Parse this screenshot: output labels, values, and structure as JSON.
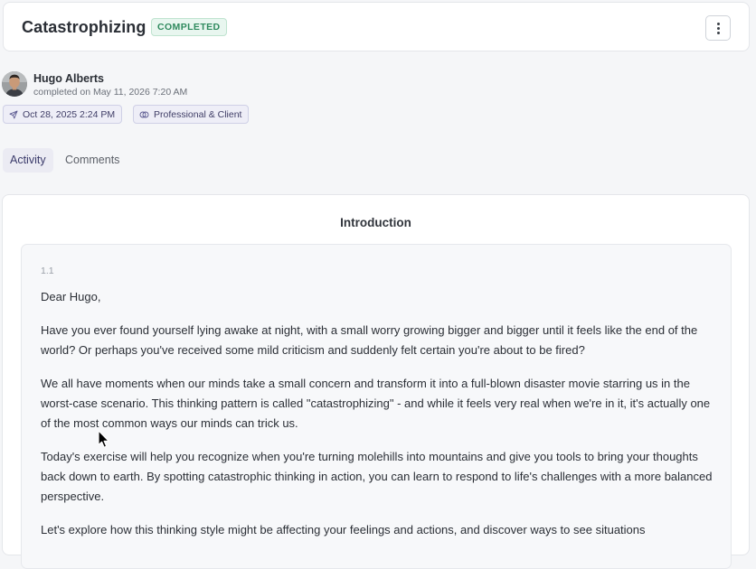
{
  "header": {
    "title": "Catastrophizing",
    "status": "COMPLETED",
    "more_icon": "more-vertical-icon"
  },
  "user": {
    "name": "Hugo Alberts",
    "completed_text": "completed on May 11, 2026 7:20 AM"
  },
  "chips": {
    "date": "Oct 28, 2025 2:24 PM",
    "relationship": "Professional & Client"
  },
  "tabs": [
    {
      "label": "Activity",
      "active": true
    },
    {
      "label": "Comments",
      "active": false
    }
  ],
  "content": {
    "section_title": "Introduction",
    "step_number": "1.1",
    "paragraphs": [
      "Dear Hugo,",
      "Have you ever found yourself lying awake at night, with a small worry growing bigger and bigger until it feels like the end of the world? Or perhaps you've received some mild criticism and suddenly felt certain you're about to be fired?",
      "We all have moments when our minds take a small concern and transform it into a full-blown disaster movie starring us in the worst-case scenario. This thinking pattern is called \"catastrophizing\" - and while it feels very real when we're in it, it's actually one of the most common ways our minds can trick us.",
      "Today's exercise will help you recognize when you're turning molehills into mountains and give you tools to bring your thoughts back down to earth. By spotting catastrophic thinking in action, you can learn to respond to life's challenges with a more balanced perspective.",
      "Let's explore how this thinking style might be affecting your feelings and actions, and discover ways to see situations"
    ]
  },
  "colors": {
    "status_text": "#2f8a5e",
    "status_bg": "#e8f6ef",
    "chip_text": "#3f3d66",
    "active_tab_bg": "#ebebf3"
  }
}
